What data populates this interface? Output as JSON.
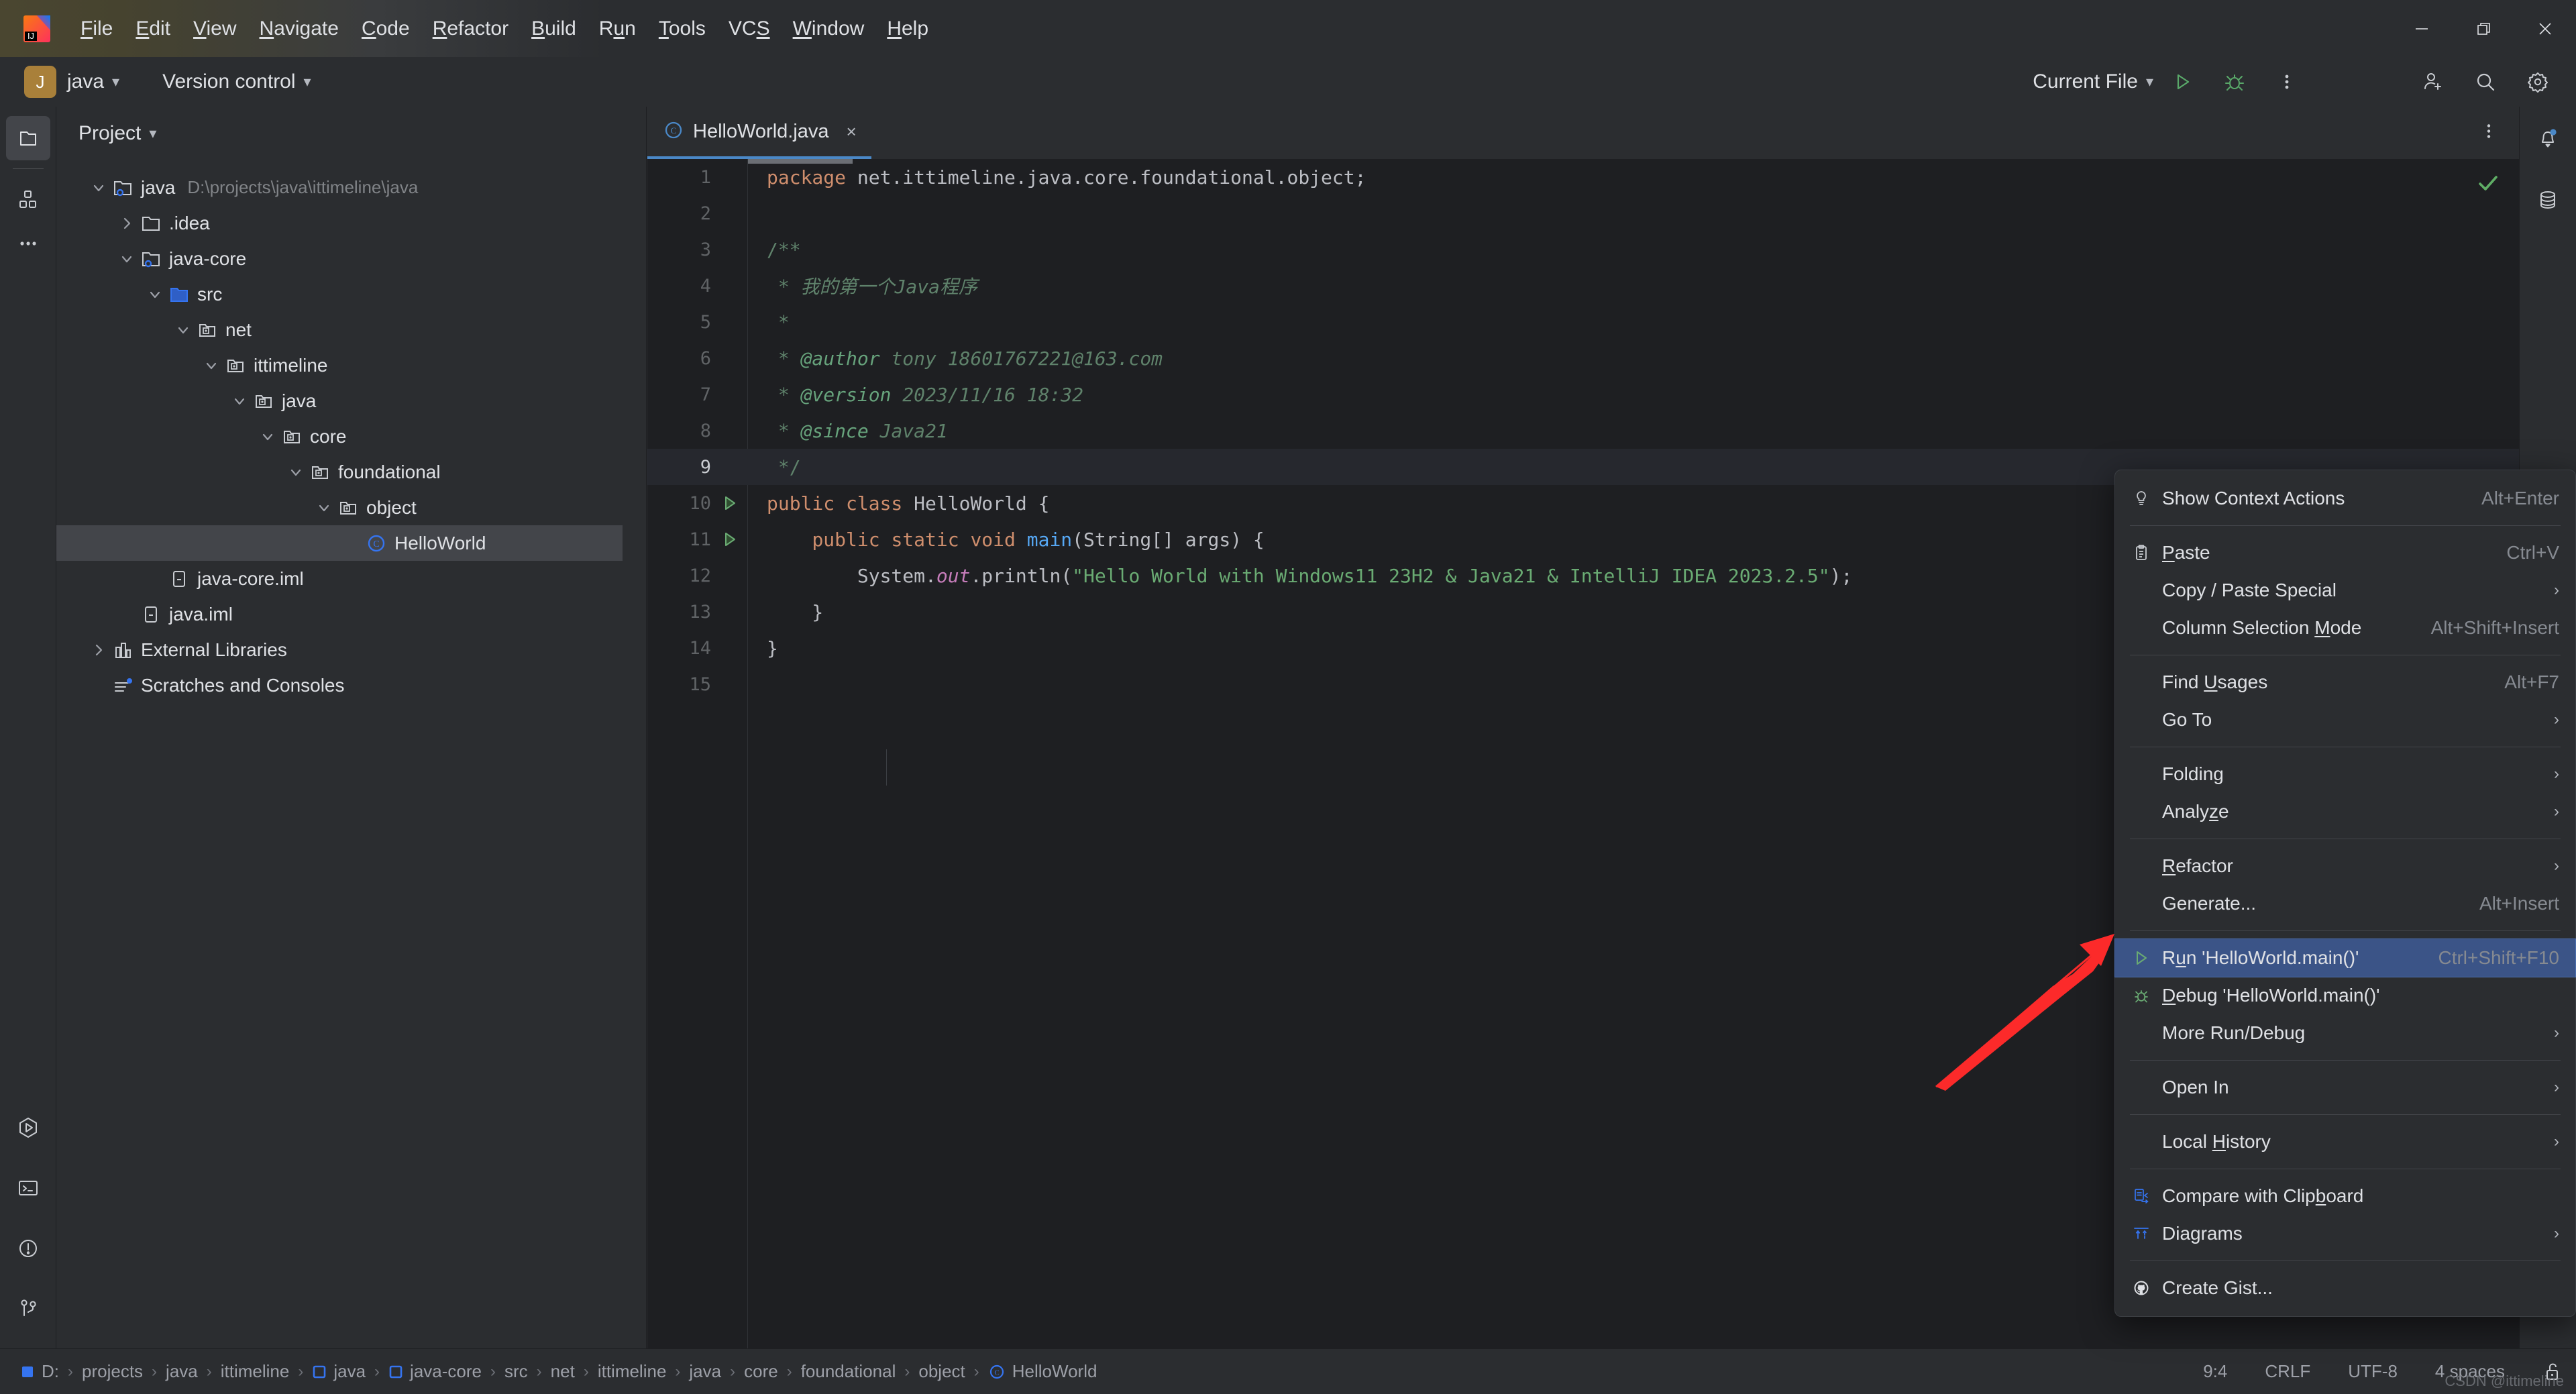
{
  "window": {
    "controls": [
      "minimize",
      "restore",
      "close"
    ]
  },
  "menubar": {
    "items": [
      {
        "label": "File",
        "mnemonic": "F"
      },
      {
        "label": "Edit",
        "mnemonic": "E"
      },
      {
        "label": "View",
        "mnemonic": "V"
      },
      {
        "label": "Navigate",
        "mnemonic": "N"
      },
      {
        "label": "Code",
        "mnemonic": "C"
      },
      {
        "label": "Refactor",
        "mnemonic": "R"
      },
      {
        "label": "Build",
        "mnemonic": "B"
      },
      {
        "label": "Run",
        "mnemonic": "u"
      },
      {
        "label": "Tools",
        "mnemonic": "T"
      },
      {
        "label": "VCS",
        "mnemonic": "S"
      },
      {
        "label": "Window",
        "mnemonic": "W"
      },
      {
        "label": "Help",
        "mnemonic": "H"
      }
    ]
  },
  "toolbar": {
    "project_badge": "J",
    "project_name": "java",
    "version_control": "Version control",
    "run_config": "Current File",
    "icons": [
      "run-icon",
      "debug-icon",
      "more-vertical-icon",
      "add-user-icon",
      "search-icon",
      "gear-icon"
    ]
  },
  "left_stripe": {
    "top": [
      "project-icon",
      "commit-icon",
      "more-tool-windows-icon"
    ],
    "bottom": [
      "run-tool-icon",
      "terminal-icon",
      "problems-icon",
      "version-control-tool-icon"
    ]
  },
  "right_stripe": {
    "items": [
      "notifications-icon",
      "database-icon"
    ]
  },
  "project_panel": {
    "title": "Project",
    "tree": [
      {
        "label": "java",
        "path": "D:\\projects\\java\\ittimeline\\java",
        "depth": 0,
        "twisty": "open",
        "icon": "module-folder-icon",
        "selected": false
      },
      {
        "label": ".idea",
        "path": "",
        "depth": 1,
        "twisty": "closed",
        "icon": "folder-icon",
        "selected": false
      },
      {
        "label": "java-core",
        "path": "",
        "depth": 1,
        "twisty": "open",
        "icon": "module-folder-icon",
        "selected": false
      },
      {
        "label": "src",
        "path": "",
        "depth": 2,
        "twisty": "open",
        "icon": "source-folder-icon",
        "selected": false
      },
      {
        "label": "net",
        "path": "",
        "depth": 3,
        "twisty": "open",
        "icon": "package-icon",
        "selected": false
      },
      {
        "label": "ittimeline",
        "path": "",
        "depth": 4,
        "twisty": "open",
        "icon": "package-icon",
        "selected": false
      },
      {
        "label": "java",
        "path": "",
        "depth": 5,
        "twisty": "open",
        "icon": "package-icon",
        "selected": false
      },
      {
        "label": "core",
        "path": "",
        "depth": 6,
        "twisty": "open",
        "icon": "package-icon",
        "selected": false
      },
      {
        "label": "foundational",
        "path": "",
        "depth": 7,
        "twisty": "open",
        "icon": "package-icon",
        "selected": false
      },
      {
        "label": "object",
        "path": "",
        "depth": 8,
        "twisty": "open",
        "icon": "package-icon",
        "selected": false
      },
      {
        "label": "HelloWorld",
        "path": "",
        "depth": 9,
        "twisty": "none",
        "icon": "java-class-icon",
        "selected": true
      },
      {
        "label": "java-core.iml",
        "path": "",
        "depth": 2,
        "twisty": "none",
        "icon": "iml-file-icon",
        "selected": false
      },
      {
        "label": "java.iml",
        "path": "",
        "depth": 1,
        "twisty": "none",
        "icon": "iml-file-icon",
        "selected": false
      },
      {
        "label": "External Libraries",
        "path": "",
        "depth": 0,
        "twisty": "closed",
        "icon": "libraries-icon",
        "selected": false
      },
      {
        "label": "Scratches and Consoles",
        "path": "",
        "depth": 0,
        "twisty": "none",
        "icon": "scratches-icon",
        "selected": false
      }
    ]
  },
  "editor": {
    "tab": {
      "label": "HelloWorld.java",
      "icon": "java-class-icon",
      "close": "×"
    },
    "inspection_status": "ok",
    "current_line": 9,
    "lines": [
      {
        "n": 1,
        "gutter": "",
        "html": "<span class=\"kw\">package</span><span class=\"plain\"> net.ittimeline.java.core.foundational.object;</span>"
      },
      {
        "n": 2,
        "gutter": "",
        "html": ""
      },
      {
        "n": 3,
        "gutter": "",
        "html": "<span class=\"cmt\">/**</span>"
      },
      {
        "n": 4,
        "gutter": "",
        "html": "<span class=\"cmt-i\"> * 我的第一个Java程序</span>"
      },
      {
        "n": 5,
        "gutter": "",
        "html": "<span class=\"cmt\"> *</span>"
      },
      {
        "n": 6,
        "gutter": "",
        "html": "<span class=\"cmt\"> * </span><span class=\"tag\">@author</span><span class=\"cmt-i\"> tony 18601767221@163.com</span>"
      },
      {
        "n": 7,
        "gutter": "",
        "html": "<span class=\"cmt\"> * </span><span class=\"tag\">@version</span><span class=\"cmt-i\"> 2023/11/16 18:32</span>"
      },
      {
        "n": 8,
        "gutter": "",
        "html": "<span class=\"cmt\"> * </span><span class=\"tag\">@since</span><span class=\"cmt-i\"> Java21</span>"
      },
      {
        "n": 9,
        "gutter": "",
        "html": "<span class=\"cmt\"> */</span>"
      },
      {
        "n": 10,
        "gutter": "run",
        "html": "<span class=\"kw\">public class</span><span class=\"plain\"> HelloWorld {</span>"
      },
      {
        "n": 11,
        "gutter": "run",
        "html": "<span class=\"plain\">    </span><span class=\"kw\">public static void</span><span class=\"plain\"> </span><span class=\"fn\">main</span><span class=\"plain\">(String[] args) {</span>"
      },
      {
        "n": 12,
        "gutter": "",
        "html": "<span class=\"plain\">        System.</span><span class=\"stat\">out</span><span class=\"plain\">.println(</span><span class=\"str\">\"Hello World with Windows11 23H2 &amp; Java21 &amp; IntelliJ IDEA 2023.2.5\"</span><span class=\"plain\">);</span>"
      },
      {
        "n": 13,
        "gutter": "",
        "html": "<span class=\"plain\">    }</span>"
      },
      {
        "n": 14,
        "gutter": "",
        "html": "<span class=\"plain\">}</span>"
      },
      {
        "n": 15,
        "gutter": "",
        "html": ""
      }
    ]
  },
  "context_menu": {
    "items": [
      {
        "type": "item",
        "label": "Show Context Actions",
        "mnemonic": "",
        "accel": "Alt+Enter",
        "icon": "lightbulb-icon",
        "arrow": false,
        "selected": false
      },
      {
        "type": "sep"
      },
      {
        "type": "item",
        "label": "Paste",
        "mnemonic": "P",
        "accel": "Ctrl+V",
        "icon": "clipboard-icon",
        "arrow": false,
        "selected": false
      },
      {
        "type": "item",
        "label": "Copy / Paste Special",
        "mnemonic": "",
        "accel": "",
        "icon": "",
        "arrow": true,
        "selected": false
      },
      {
        "type": "item",
        "label": "Column Selection Mode",
        "mnemonic": "M",
        "accel": "Alt+Shift+Insert",
        "icon": "",
        "arrow": false,
        "selected": false
      },
      {
        "type": "sep"
      },
      {
        "type": "item",
        "label": "Find Usages",
        "mnemonic": "U",
        "accel": "Alt+F7",
        "icon": "",
        "arrow": false,
        "selected": false
      },
      {
        "type": "item",
        "label": "Go To",
        "mnemonic": "",
        "accel": "",
        "icon": "",
        "arrow": true,
        "selected": false
      },
      {
        "type": "sep"
      },
      {
        "type": "item",
        "label": "Folding",
        "mnemonic": "",
        "accel": "",
        "icon": "",
        "arrow": true,
        "selected": false
      },
      {
        "type": "item",
        "label": "Analyze",
        "mnemonic": "z",
        "accel": "",
        "icon": "",
        "arrow": true,
        "selected": false
      },
      {
        "type": "sep"
      },
      {
        "type": "item",
        "label": "Refactor",
        "mnemonic": "R",
        "accel": "",
        "icon": "",
        "arrow": true,
        "selected": false
      },
      {
        "type": "item",
        "label": "Generate...",
        "mnemonic": "",
        "accel": "Alt+Insert",
        "icon": "",
        "arrow": false,
        "selected": false
      },
      {
        "type": "sep"
      },
      {
        "type": "item",
        "label": "Run 'HelloWorld.main()'",
        "mnemonic": "u",
        "accel": "Ctrl+Shift+F10",
        "icon": "run-icon",
        "arrow": false,
        "selected": true
      },
      {
        "type": "item",
        "label": "Debug 'HelloWorld.main()'",
        "mnemonic": "D",
        "accel": "",
        "icon": "debug-icon",
        "arrow": false,
        "selected": false
      },
      {
        "type": "item",
        "label": "More Run/Debug",
        "mnemonic": "",
        "accel": "",
        "icon": "",
        "arrow": true,
        "selected": false
      },
      {
        "type": "sep"
      },
      {
        "type": "item",
        "label": "Open In",
        "mnemonic": "",
        "accel": "",
        "icon": "",
        "arrow": true,
        "selected": false
      },
      {
        "type": "sep"
      },
      {
        "type": "item",
        "label": "Local History",
        "mnemonic": "H",
        "accel": "",
        "icon": "",
        "arrow": true,
        "selected": false
      },
      {
        "type": "sep"
      },
      {
        "type": "item",
        "label": "Compare with Clipboard",
        "mnemonic": "b",
        "accel": "",
        "icon": "compare-clipboard-icon",
        "arrow": false,
        "selected": false
      },
      {
        "type": "item",
        "label": "Diagrams",
        "mnemonic": "",
        "accel": "",
        "icon": "diagrams-icon",
        "arrow": true,
        "selected": false
      },
      {
        "type": "sep"
      },
      {
        "type": "item",
        "label": "Create Gist...",
        "mnemonic": "",
        "accel": "",
        "icon": "github-icon",
        "arrow": false,
        "selected": false
      }
    ]
  },
  "status_bar": {
    "breadcrumbs": [
      {
        "label": "D:",
        "icon": "drive-icon"
      },
      {
        "label": "projects",
        "icon": ""
      },
      {
        "label": "java",
        "icon": ""
      },
      {
        "label": "ittimeline",
        "icon": ""
      },
      {
        "label": "java",
        "icon": "module-icon"
      },
      {
        "label": "java-core",
        "icon": "module-icon"
      },
      {
        "label": "src",
        "icon": ""
      },
      {
        "label": "net",
        "icon": ""
      },
      {
        "label": "ittimeline",
        "icon": ""
      },
      {
        "label": "java",
        "icon": ""
      },
      {
        "label": "core",
        "icon": ""
      },
      {
        "label": "foundational",
        "icon": ""
      },
      {
        "label": "object",
        "icon": ""
      },
      {
        "label": "HelloWorld",
        "icon": "java-class-icon"
      }
    ],
    "separator": "›",
    "caret": "9:4",
    "line_separator": "CRLF",
    "encoding": "UTF-8",
    "indent": "4 spaces",
    "lock": "unlocked-icon"
  },
  "watermark": "CSDN @ittimeline",
  "colors": {
    "accent_blue": "#4a88c7",
    "selection_blue": "#3b5487",
    "panel_bg": "#2b2d30",
    "editor_bg": "#1e1f22",
    "annotation_red": "#fc2a2a",
    "run_green": "#59a869"
  }
}
